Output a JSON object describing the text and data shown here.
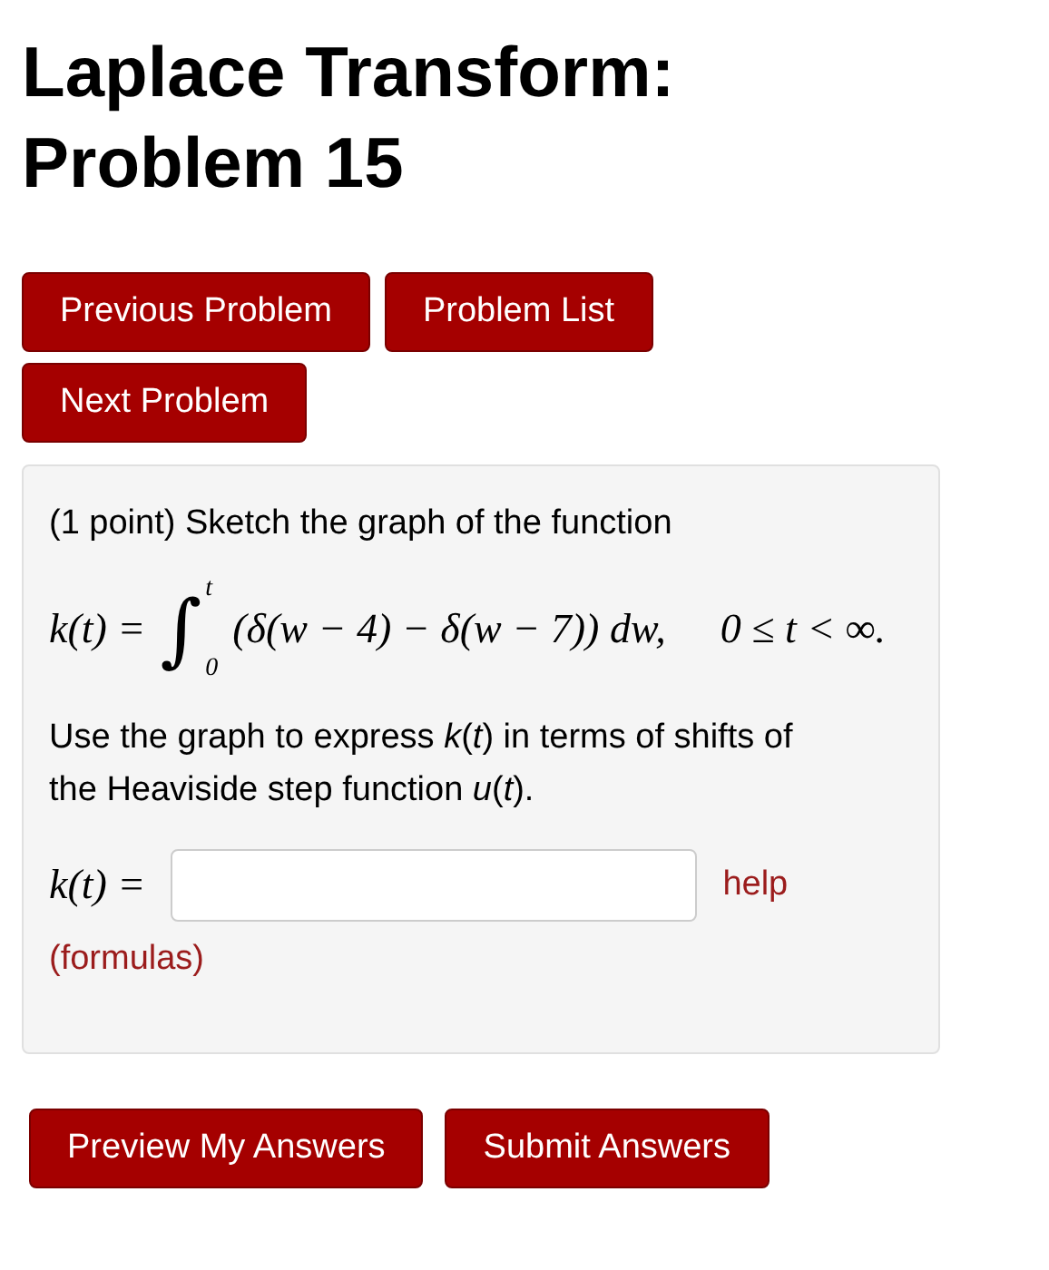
{
  "title": "Laplace Transform: Problem 15",
  "nav_buttons": [
    "Previous Problem",
    "Problem List",
    "Next Problem"
  ],
  "problem": {
    "intro": "(1 point) Sketch the graph of the function",
    "equation": {
      "lhs": "k(t) =",
      "integral_sign": "∫",
      "upper_limit": "t",
      "lower_limit": "0",
      "integrand": "(δ(w − 4) − δ(w − 7)) dw,",
      "condition": "0 ≤ t < ∞."
    },
    "instruction": "Use the graph to express *k*(*t*) in terms of shifts of the Heaviside step function *u*(*t*).",
    "answer": {
      "label": "k(t) =",
      "help_link": "help"
    },
    "formulas_link": "(formulas)"
  },
  "submit_buttons": [
    "Preview My Answers",
    "Submit Answers"
  ]
}
